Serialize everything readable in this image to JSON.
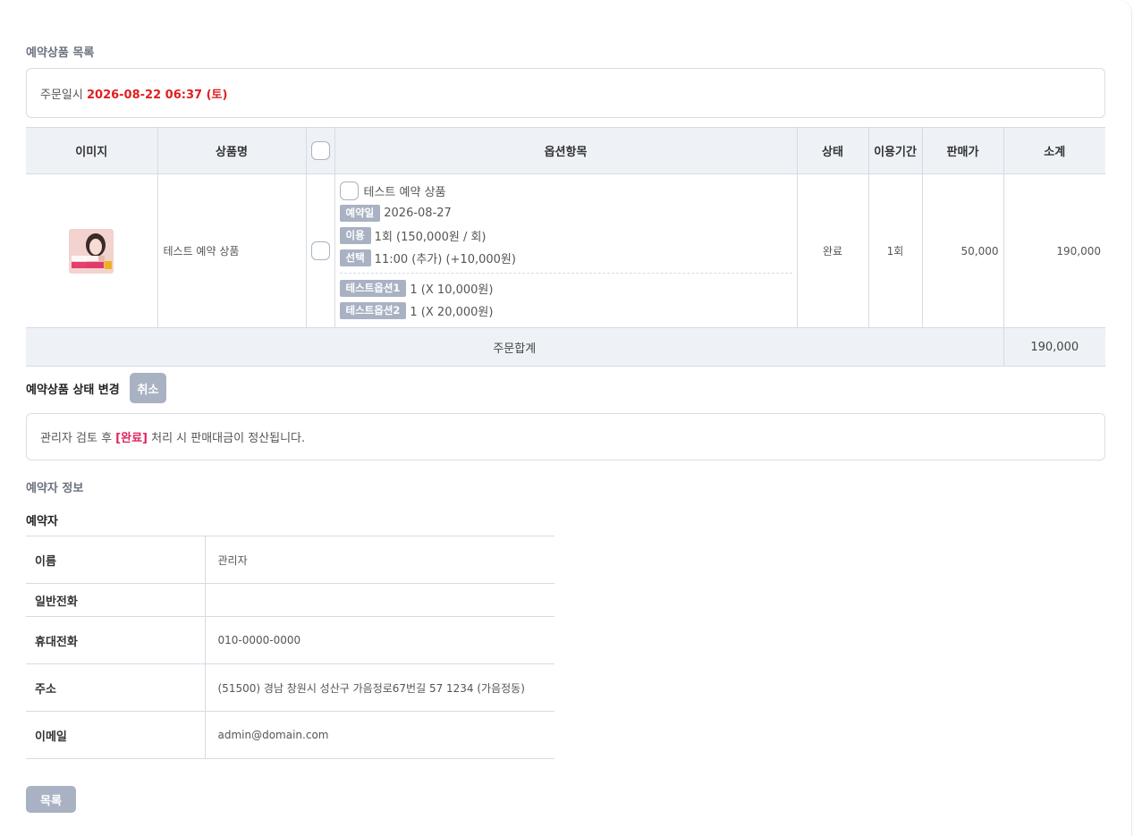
{
  "section_list_title": "예약상품 목록",
  "order": {
    "label": "주문일시",
    "datetime": "2026-08-22 06:37 (토)"
  },
  "product_table": {
    "headers": {
      "image": "이미지",
      "name": "상품명",
      "options": "옵션항목",
      "status": "상태",
      "period": "이용기간",
      "price": "판매가",
      "subtotal": "소계"
    },
    "row": {
      "name": "테스트 예약 상품",
      "option_title": "테스트 예약 상품",
      "opt_date_tag": "예약일",
      "opt_date_value": "2026-08-27",
      "opt_use_tag": "이용",
      "opt_use_value": "1회 (150,000원 / 회)",
      "opt_sel_tag": "선택",
      "opt_sel_value": "11:00 (추가) (+10,000원)",
      "opt1_tag": "테스트옵션1",
      "opt1_value": "1 (X 10,000원)",
      "opt2_tag": "테스트옵션2",
      "opt2_value": "1 (X 20,000원)",
      "status": "완료",
      "period": "1회",
      "price": "50,000",
      "subtotal": "190,000"
    },
    "sum_label": "주문합계",
    "sum_value": "190,000"
  },
  "status_change": {
    "label": "예약상품 상태 변경",
    "cancel_button": "취소"
  },
  "notice": {
    "prefix": "관리자 검토 후 ",
    "highlight": "[완료]",
    "suffix": " 처리 시 판매대금이 정산됩니다."
  },
  "booker_section_title": "예약자 정보",
  "booker_subtitle": "예약자",
  "booker": {
    "name_label": "이름",
    "name_value": "관리자",
    "phone_label": "일반전화",
    "phone_value": "",
    "mobile_label": "휴대전화",
    "mobile_value": "010-0000-0000",
    "address_label": "주소",
    "address_value": "(51500) 경남 창원시 성산구 가음정로67번길 57 1234 (가음정동)",
    "email_label": "이메일",
    "email_value": "admin@domain.com"
  },
  "list_button": "목록",
  "colors": {
    "accent_red": "#e02020",
    "highlight_pink": "#e0245e",
    "header_bg": "#eef2f7",
    "tag_gray": "#a9b2c3"
  }
}
